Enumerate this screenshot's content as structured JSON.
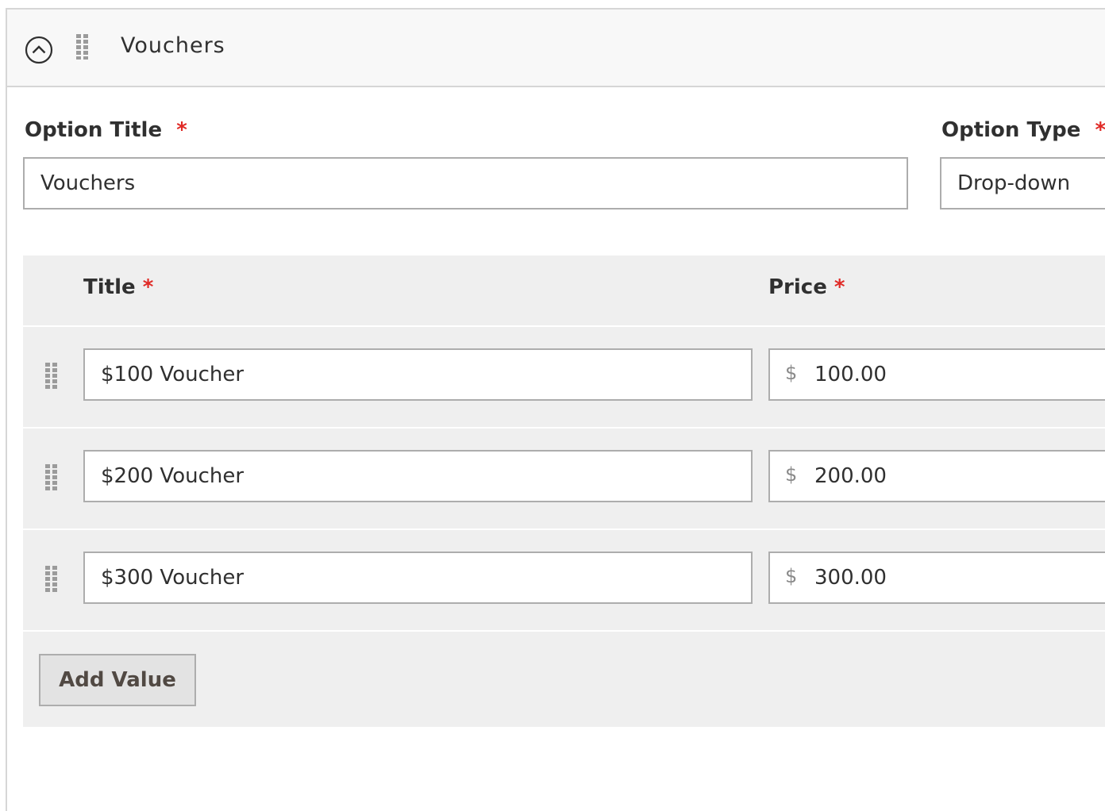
{
  "panel": {
    "title": "Vouchers",
    "collapse_icon": "circle-chevron-up-icon",
    "drag_icon": "drag-handle-icon"
  },
  "option_title": {
    "label": "Option Title",
    "required_mark": "*",
    "value": "Vouchers"
  },
  "option_type": {
    "label": "Option Type",
    "required_mark": "*",
    "value": "Drop-down"
  },
  "values_table": {
    "columns": {
      "title_label": "Title",
      "price_label": "Price",
      "required_mark": "*"
    },
    "currency_symbol": "$",
    "rows": [
      {
        "title": "$100 Voucher",
        "price": "100.00"
      },
      {
        "title": "$200 Voucher",
        "price": "200.00"
      },
      {
        "title": "$300 Voucher",
        "price": "300.00"
      }
    ],
    "add_button_label": "Add Value"
  },
  "colors": {
    "required": "#e02b27",
    "header_bg": "#f8f8f8",
    "table_bg": "#efefef",
    "border": "#adadad",
    "button_bg": "#e3e3e3"
  }
}
